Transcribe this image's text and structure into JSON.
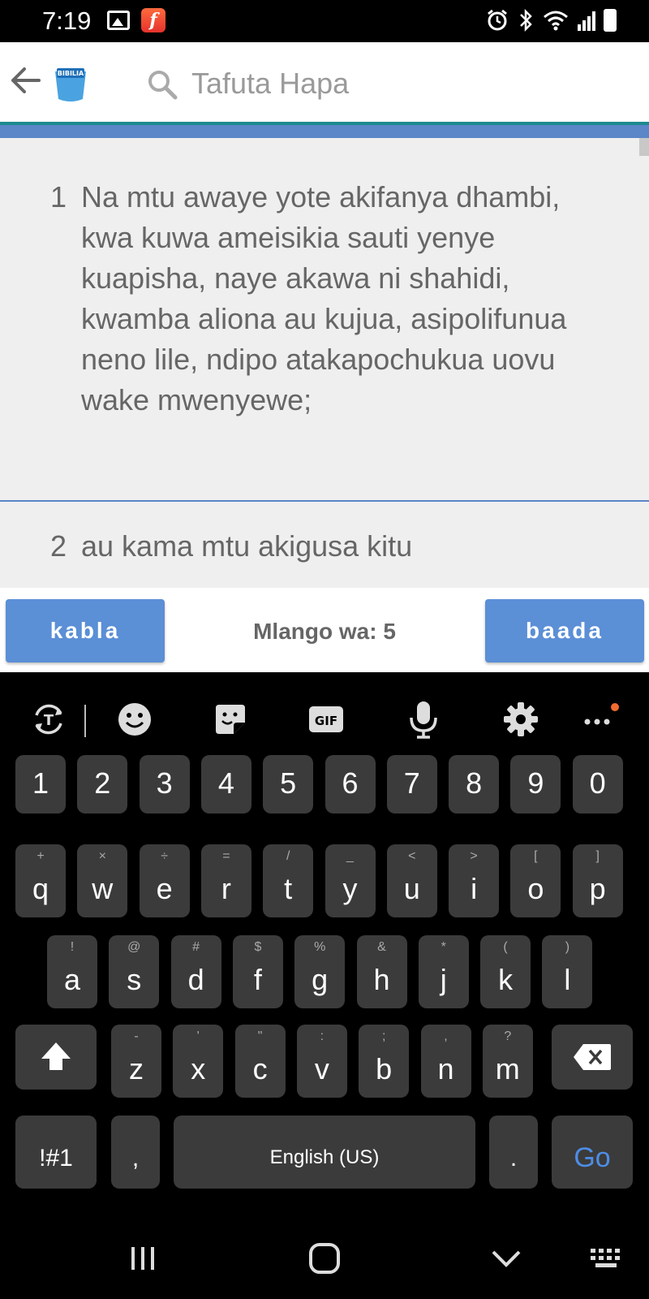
{
  "status_bar": {
    "time": "7:19",
    "icons": [
      "gallery-icon",
      "flash-app-icon",
      "alarm-icon",
      "bluetooth-icon",
      "wifi-icon",
      "signal-icon",
      "battery-icon"
    ],
    "flash_letter": "f"
  },
  "app_bar": {
    "logo_text": "BIBILIA",
    "search_placeholder": "Tafuta Hapa"
  },
  "verses": [
    {
      "number": "1",
      "text": "Na mtu awaye yote akifanya dhambi, kwa kuwa ameisikia sauti yenye kuapisha, naye akawa ni shahidi, kwamba aliona au kujua, asipolifunua neno lile, ndipo atakapochukua uovu wake mwenyewe;"
    },
    {
      "number": "2",
      "text": "au kama mtu akigusa kitu"
    }
  ],
  "pager": {
    "prev_label": "kabla",
    "chapter_label": "Mlango wa: 5",
    "next_label": "baada"
  },
  "keyboard": {
    "toolbar": [
      "translate-icon",
      "emoji-icon",
      "sticker-icon",
      "gif-icon",
      "mic-icon",
      "settings-icon",
      "more-icon"
    ],
    "gif_label": "GIF",
    "number_row": [
      "1",
      "2",
      "3",
      "4",
      "5",
      "6",
      "7",
      "8",
      "9",
      "0"
    ],
    "row1": [
      {
        "key": "q",
        "sub": "+"
      },
      {
        "key": "w",
        "sub": "×"
      },
      {
        "key": "e",
        "sub": "÷"
      },
      {
        "key": "r",
        "sub": "="
      },
      {
        "key": "t",
        "sub": "/"
      },
      {
        "key": "y",
        "sub": "_"
      },
      {
        "key": "u",
        "sub": "<"
      },
      {
        "key": "i",
        "sub": ">"
      },
      {
        "key": "o",
        "sub": "["
      },
      {
        "key": "p",
        "sub": "]"
      }
    ],
    "row2": [
      {
        "key": "a",
        "sub": "!"
      },
      {
        "key": "s",
        "sub": "@"
      },
      {
        "key": "d",
        "sub": "#"
      },
      {
        "key": "f",
        "sub": "$"
      },
      {
        "key": "g",
        "sub": "%"
      },
      {
        "key": "h",
        "sub": "&"
      },
      {
        "key": "j",
        "sub": "*"
      },
      {
        "key": "k",
        "sub": "("
      },
      {
        "key": "l",
        "sub": ")"
      }
    ],
    "row3": [
      {
        "key": "z",
        "sub": "-"
      },
      {
        "key": "x",
        "sub": "'"
      },
      {
        "key": "c",
        "sub": "\""
      },
      {
        "key": "v",
        "sub": ":"
      },
      {
        "key": "b",
        "sub": ";"
      },
      {
        "key": "n",
        "sub": ","
      },
      {
        "key": "m",
        "sub": "?"
      }
    ],
    "symbols_label": "!#1",
    "comma_label": ",",
    "space_label": "English (US)",
    "period_label": ".",
    "go_label": "Go"
  },
  "nav_bar": [
    "recents-icon",
    "home-icon",
    "back-chevron-icon",
    "keyboard-switch-icon"
  ]
}
